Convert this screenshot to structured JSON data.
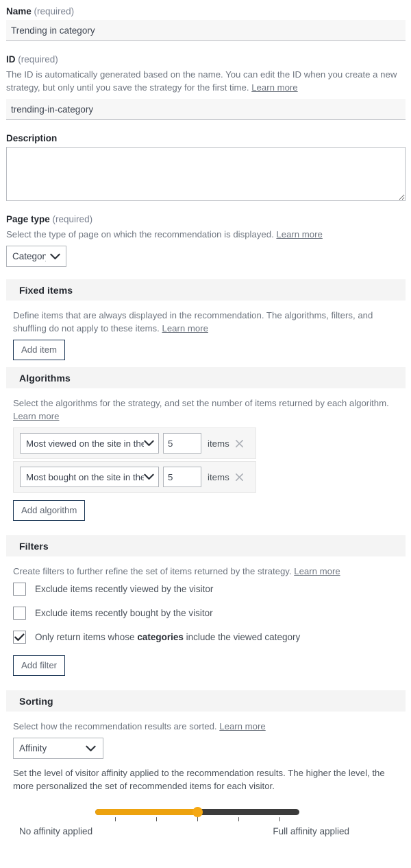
{
  "form": {
    "name": {
      "label": "Name",
      "required_suffix": "(required)",
      "value": "Trending in category"
    },
    "id": {
      "label": "ID",
      "required_suffix": "(required)",
      "help": "The ID is automatically generated based on the name. You can edit the ID when you create a new strategy, but only until you save the strategy for the first time.",
      "learn_more": "Learn more",
      "value": "trending-in-category"
    },
    "description": {
      "label": "Description",
      "value": ""
    },
    "page_type": {
      "label": "Page type",
      "required_suffix": "(required)",
      "help": "Select the type of page on which the recommendation is displayed.",
      "learn_more": "Learn more",
      "selected": "Category"
    }
  },
  "fixed_items": {
    "title": "Fixed items",
    "help": "Define items that are always displayed in the recommendation. The algorithms, filters, and shuffling do not apply to these items.",
    "learn_more": "Learn more",
    "add_button": "Add item"
  },
  "algorithms": {
    "title": "Algorithms",
    "help": "Select the algorithms for the strategy, and set the number of items returned by each algorithm.",
    "learn_more": "Learn more",
    "unit_label": "items",
    "remove_icon": "close-icon",
    "rows": [
      {
        "algorithm": "Most viewed on the site in the pa",
        "count": "5"
      },
      {
        "algorithm": "Most bought on the site in the pa",
        "count": "5"
      }
    ],
    "add_button": "Add algorithm"
  },
  "filters": {
    "title": "Filters",
    "help": "Create filters to further refine the set of items returned by the strategy.",
    "learn_more": "Learn more",
    "items": [
      {
        "label": "Exclude items recently viewed by the visitor",
        "checked": false
      },
      {
        "label": "Exclude items recently bought by the visitor",
        "checked": false
      },
      {
        "label_pre": "Only return items whose ",
        "label_bold": "categories",
        "label_post": " include the viewed category",
        "checked": true
      }
    ],
    "add_button": "Add filter"
  },
  "sorting": {
    "title": "Sorting",
    "help": "Select how the recommendation results are sorted.",
    "learn_more": "Learn more",
    "selected": "Affinity",
    "affinity_help": "Set the level of visitor affinity applied to the recommendation results. The higher the level, the more personalized the set of recommended items for each visitor.",
    "slider": {
      "value_percent": 50,
      "tick_count": 5,
      "min_label": "No affinity applied",
      "max_label": "Full affinity applied",
      "fill_color": "#eda20e",
      "track_color": "#3b3b3b",
      "thumb_color": "#f5a813"
    }
  }
}
